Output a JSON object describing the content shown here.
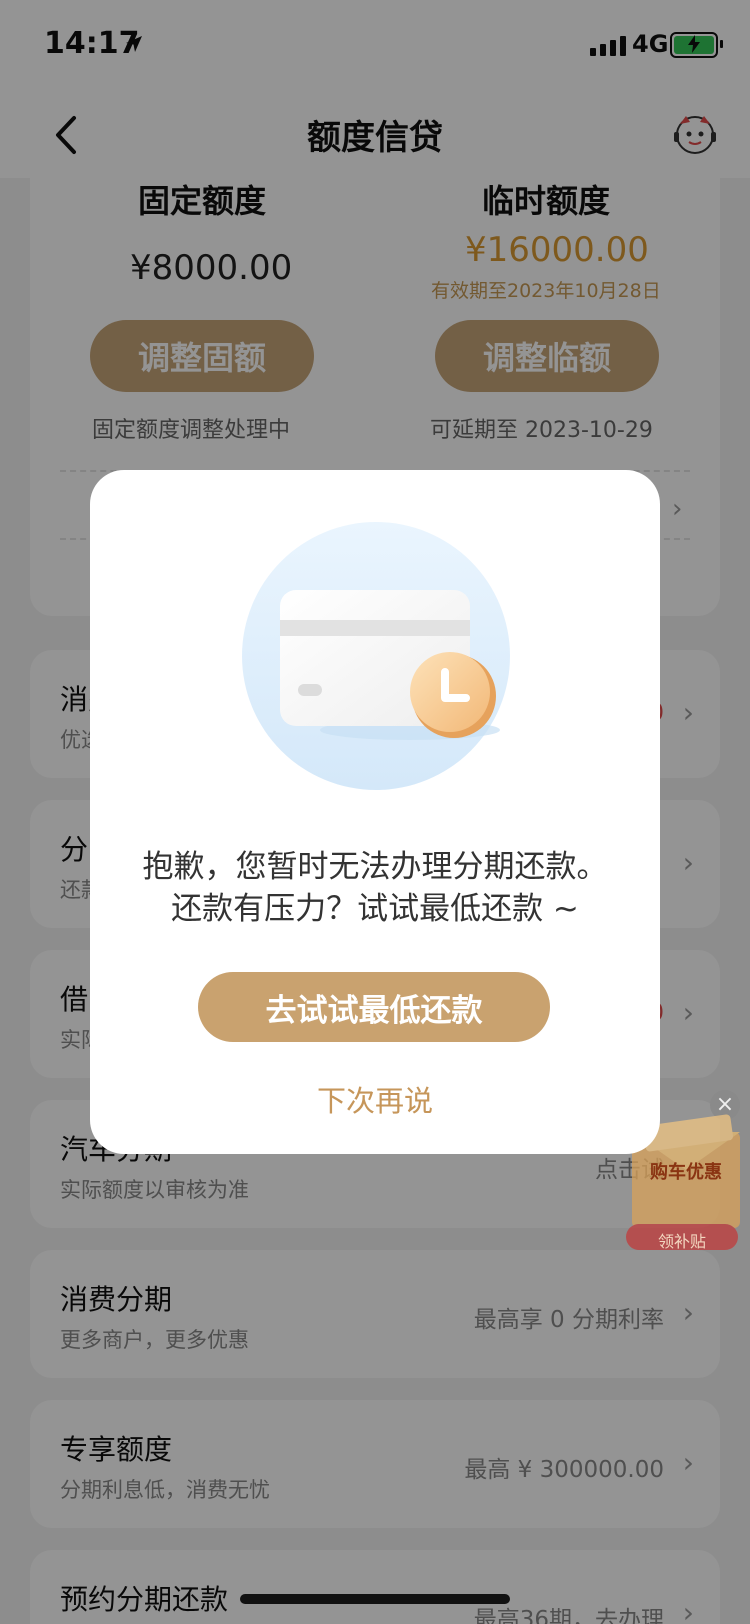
{
  "status": {
    "time": "14:17",
    "network": "4G"
  },
  "nav": {
    "title": "额度信贷"
  },
  "quota": {
    "fixed": {
      "title": "固定额度",
      "amount": "¥8000.00",
      "button": "调整固额",
      "status": "固定额度调整处理中"
    },
    "temp": {
      "title": "临时额度",
      "amount": "¥16000.00",
      "validity": "有效期至2023年10月28日",
      "button": "调整临额",
      "status": "可延期至 2023-10-29"
    }
  },
  "cards": [
    {
      "title": "消费",
      "subtitle": "优选",
      "right": "0"
    },
    {
      "title": "分",
      "subtitle": "还款",
      "right": ""
    },
    {
      "title": "借",
      "subtitle": "实际",
      "right": "0"
    },
    {
      "title": "汽车分期",
      "subtitle": "实际额度以审核为准",
      "right": "点击试"
    },
    {
      "title": "消费分期",
      "subtitle": "更多商户，更多优惠",
      "right": "最高享 0 分期利率"
    },
    {
      "title": "专享额度",
      "subtitle": "分期利息低，消费无忧",
      "right": "最高 ¥ 300000.00"
    },
    {
      "title": "预约分期还款",
      "subtitle": "",
      "right": "最高36期，去办理"
    }
  ],
  "promo": {
    "title": "购车优惠",
    "badge": "领补贴"
  },
  "modal": {
    "line1": "抱歉，您暂时无法办理分期还款。",
    "line2": "还款有压力？试试最低还款 ~",
    "primary_button": "去试试最低还款",
    "secondary_button": "下次再说"
  },
  "colors": {
    "accent": "#c9a26f",
    "highlight": "#d99a33"
  }
}
